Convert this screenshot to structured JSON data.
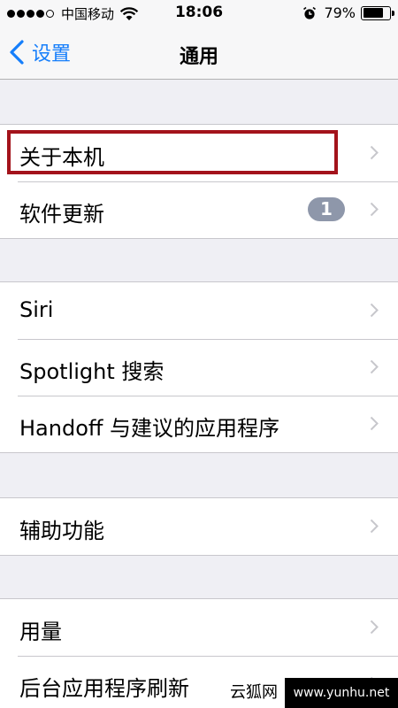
{
  "status_bar": {
    "carrier": "中国移动",
    "time": "18:06",
    "battery_percent": "79%",
    "battery_level": 0.79
  },
  "nav": {
    "back_label": "设置",
    "title": "通用"
  },
  "groups": [
    {
      "rows": [
        {
          "label": "关于本机"
        },
        {
          "label": "软件更新",
          "badge": "1"
        }
      ]
    },
    {
      "rows": [
        {
          "label": "Siri"
        },
        {
          "label": "Spotlight 搜索"
        },
        {
          "label": "Handoff 与建议的应用程序"
        }
      ]
    },
    {
      "rows": [
        {
          "label": "辅助功能"
        }
      ]
    },
    {
      "rows": [
        {
          "label": "用量"
        },
        {
          "label": "后台应用程序刷新"
        }
      ]
    }
  ],
  "watermark": {
    "left": "云狐网",
    "right": "www.yunhu.net"
  },
  "colors": {
    "tint": "#157efb",
    "highlight": "#a3131b",
    "badge": "#8e97aa"
  }
}
